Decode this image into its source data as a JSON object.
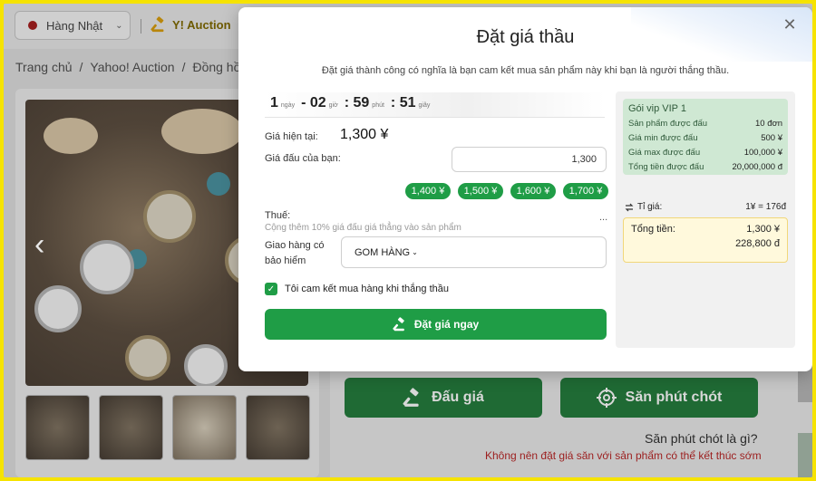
{
  "background": {
    "language": "Hàng Nhật",
    "site": "Y! Auction",
    "breadcrumb": [
      "Trang chủ",
      "/",
      "Yahoo! Auction",
      "/",
      "Đồng hồ"
    ],
    "bid_button": "Đấu giá",
    "snipe_button": "Săn phút chót",
    "snipe_help": "Săn phút chót là gì?",
    "snipe_warning": "Không nên đặt giá săn với sản phẩm có thể kết thúc sớm"
  },
  "modal": {
    "title": "Đặt giá thầu",
    "note": "Đặt giá thành công có nghĩa là bạn cam kết mua sản phẩm này khi bạn là người thắng thầu.",
    "close_icon": "close-icon",
    "timer": {
      "days": "1",
      "days_unit": "ngày",
      "hours": "- 02",
      "hours_unit": "giờ",
      "minutes": ": 59",
      "minutes_unit": "phút",
      "seconds": ": 51",
      "seconds_unit": "giây"
    },
    "current_price_label": "Giá hiện tại:",
    "current_price": "1,300 ¥",
    "your_bid_label": "Giá đấu của bạn:",
    "your_bid_value": "1,300",
    "quick_bids": [
      "1,400 ¥",
      "1,500 ¥",
      "1,600 ¥",
      "1,700 ¥"
    ],
    "tax_label": "Thuế:",
    "tax_note": "Cộng thêm 10% giá đấu giá thẳng vào sản phẩm",
    "tax_value": "...",
    "shipping_label_1": "Giao hàng có",
    "shipping_label_2": "bảo hiểm",
    "shipping_value": "GOM HÀNG",
    "agree_text": "Tôi cam kết mua hàng khi thắng thầu",
    "submit_label": "Đặt giá ngay",
    "summary": {
      "vip_title": "Gói vip VIP 1",
      "rows": [
        {
          "label": "Sản phẩm được đấu",
          "value": "10 đơn"
        },
        {
          "label": "Giá min được đấu",
          "value": "500 ¥"
        },
        {
          "label": "Giá max được đấu",
          "value": "100,000 ¥"
        },
        {
          "label": "Tổng tiền được đấu",
          "value": "20,000,000 đ"
        }
      ],
      "rate_label": "Tỉ giá:",
      "rate_value": "1¥ = 176đ",
      "total_label": "Tổng tiền:",
      "total_yen": "1,300 ¥",
      "total_vnd": "228,800 đ"
    }
  },
  "colors": {
    "accent_green": "#1f9d46",
    "frame_yellow": "#f6e300",
    "vip_bg": "#cfe8d3",
    "total_bg": "#fff9dc"
  }
}
